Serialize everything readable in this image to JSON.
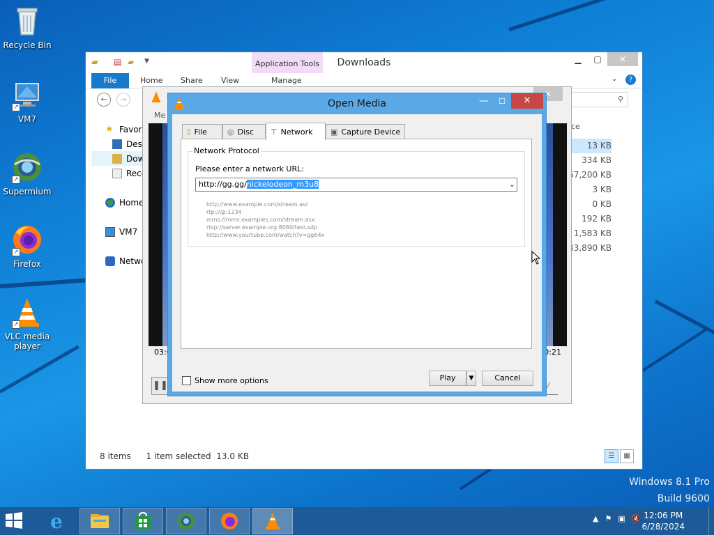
{
  "desktop": {
    "icons": [
      {
        "label": "Recycle Bin",
        "icon": "recycle-bin-icon"
      },
      {
        "label": "VM7",
        "icon": "computer-icon"
      },
      {
        "label": "Supermium",
        "icon": "supermium-icon"
      },
      {
        "label": "Firefox",
        "icon": "firefox-icon"
      },
      {
        "label": "VLC media player",
        "icon": "vlc-icon"
      }
    ],
    "watermark": {
      "line1": "Windows 8.1 Pro",
      "line2": "Build 9600"
    }
  },
  "explorer": {
    "title": "Downloads",
    "context_tab": "Application Tools",
    "tabs": [
      "File",
      "Home",
      "Share",
      "View",
      "Manage"
    ],
    "nav": [
      "Favori",
      "Desk",
      "Dow",
      "Rece",
      "Home",
      "VM7",
      "Netwo"
    ],
    "partial_header": "ce",
    "sizes": [
      "13 KB",
      "334 KB",
      "57,200 KB",
      "3 KB",
      "0 KB",
      "192 KB",
      "1,583 KB",
      "43,890 KB"
    ],
    "status_items": "8 items",
    "status_selected": "1 item selected  13.0 KB"
  },
  "vlc": {
    "menu_partial": "Me",
    "time_left": "03:0",
    "time_right": "0:21"
  },
  "dialog": {
    "title": "Open Media",
    "tabs": [
      {
        "label": "File",
        "icon": "file-icon"
      },
      {
        "label": "Disc",
        "icon": "disc-icon"
      },
      {
        "label": "Network",
        "icon": "network-icon"
      },
      {
        "label": "Capture Device",
        "icon": "capture-device-icon"
      }
    ],
    "group_title": "Network Protocol",
    "prompt": "Please enter a network URL:",
    "url_prefix": "http://gg.gg/",
    "url_selected": "nickelodeon_m3u8",
    "examples": [
      "http://www.example.com/stream.avi",
      "rtp://@:1234",
      "mms://mms.examples.com/stream.asx",
      "rtsp://server.example.org:8080/test.sdp",
      "http://www.yourtube.com/watch?v=gg64x"
    ],
    "show_more": "Show more options",
    "play": "Play",
    "cancel": "Cancel"
  },
  "taskbar": {
    "time": "12:06 PM",
    "date": "6/28/2024",
    "apps": [
      "internet-explorer-icon",
      "file-explorer-icon",
      "store-icon",
      "supermium-icon",
      "firefox-icon",
      "vlc-icon"
    ]
  }
}
